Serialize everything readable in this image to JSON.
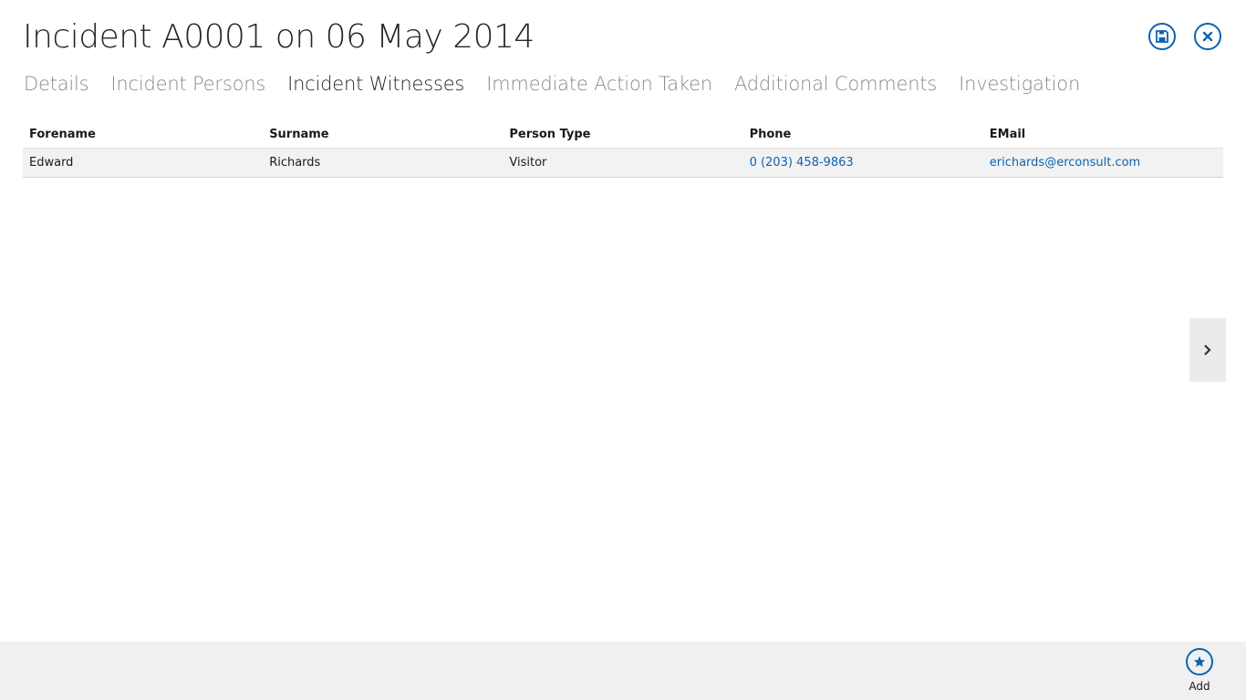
{
  "header": {
    "title": "Incident A0001 on 06 May 2014",
    "save_icon": "save-icon",
    "close_icon": "close-icon"
  },
  "tabs": [
    {
      "label": "Details",
      "active": false
    },
    {
      "label": "Incident Persons",
      "active": false
    },
    {
      "label": "Incident Witnesses",
      "active": true
    },
    {
      "label": "Immediate Action Taken",
      "active": false
    },
    {
      "label": "Additional Comments",
      "active": false
    },
    {
      "label": "Investigation",
      "active": false
    }
  ],
  "witnesses": {
    "columns": [
      "Forename",
      "Surname",
      "Person Type",
      "Phone",
      "EMail"
    ],
    "rows": [
      {
        "forename": "Edward",
        "surname": "Richards",
        "person_type": "Visitor",
        "phone": "0 (203) 458-9863",
        "email": "erichards@erconsult.com"
      }
    ]
  },
  "navigation": {
    "next_icon": "chevron-right-icon"
  },
  "appbar": {
    "add_label": "Add",
    "add_icon": "star-icon"
  },
  "colors": {
    "accent": "#0b63b2",
    "appbar_bg": "#f0f0f0",
    "row_bg": "#f2f2f2"
  }
}
